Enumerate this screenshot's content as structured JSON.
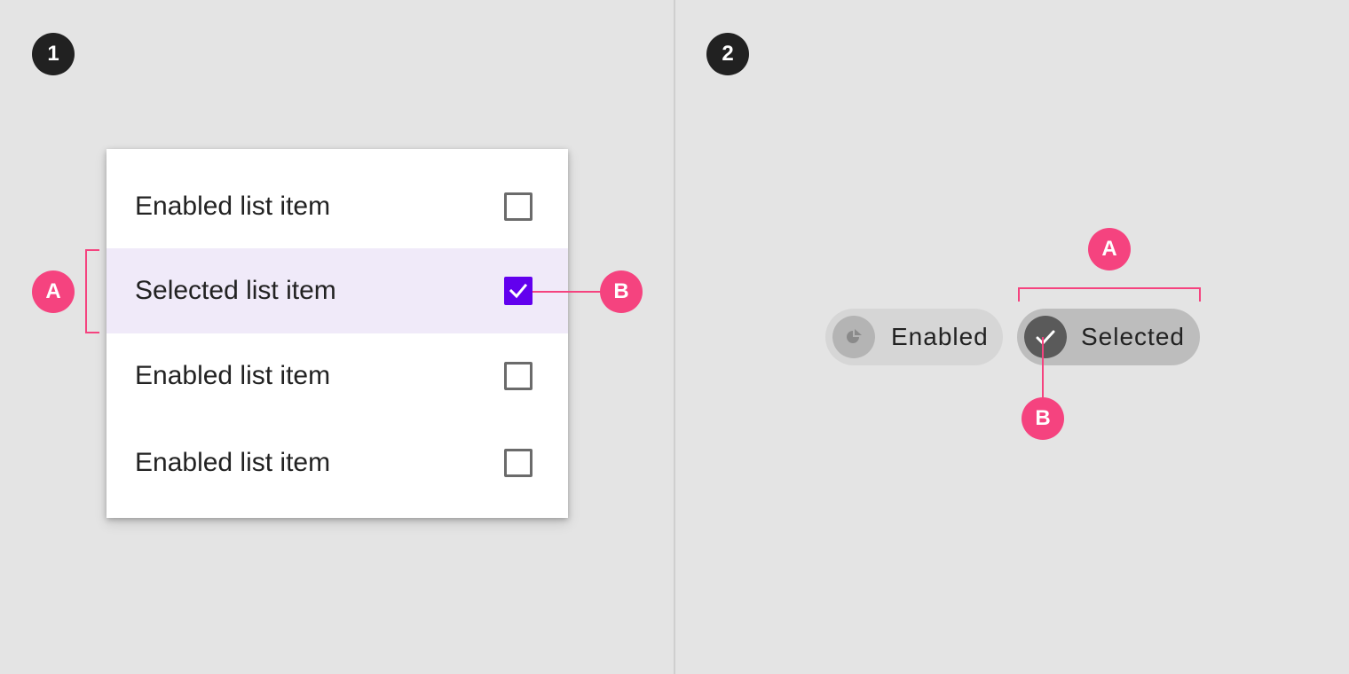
{
  "panel_1": {
    "step": "1",
    "list_items": [
      {
        "label": "Enabled list item",
        "checked": false,
        "state": "enabled"
      },
      {
        "label": "Selected list item",
        "checked": true,
        "state": "selected"
      },
      {
        "label": "Enabled list item",
        "checked": false,
        "state": "enabled"
      },
      {
        "label": "Enabled list item",
        "checked": false,
        "state": "enabled"
      }
    ],
    "annotations": {
      "a": "A",
      "b": "B"
    }
  },
  "panel_2": {
    "step": "2",
    "chips": [
      {
        "label": "Enabled",
        "icon": "pie-chart-icon",
        "selected": false
      },
      {
        "label": "Selected",
        "icon": "check-icon",
        "selected": true
      }
    ],
    "annotations": {
      "a": "A",
      "b": "B"
    }
  },
  "colors": {
    "background": "#e4e4e4",
    "annotation": "#f5437f",
    "selected_list_bg": "#f0eaf9",
    "checkbox_checked": "#6200ee",
    "step_badge": "#212121"
  }
}
